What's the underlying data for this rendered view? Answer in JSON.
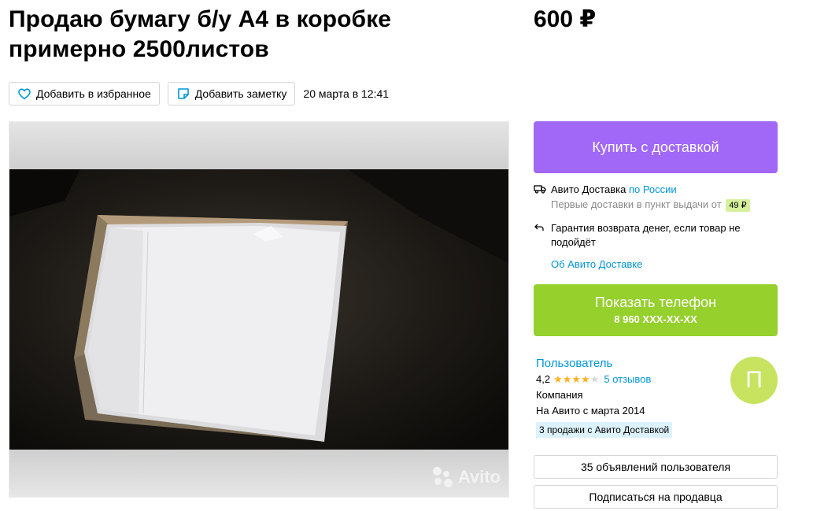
{
  "listing": {
    "title": "Продаю бумагу б/у А4 в коробке примерно 2500листов",
    "price": "600 ₽",
    "date": "20 марта в 12:41"
  },
  "actions": {
    "favorite_label": "Добавить в избранное",
    "note_label": "Добавить заметку"
  },
  "photo": {
    "watermark": "Avito"
  },
  "buy": {
    "label": "Купить с доставкой"
  },
  "delivery": {
    "service_label": "Авито Доставка",
    "region_link": "по России",
    "first_delivery_text": "Первые доставки в пункт выдачи от",
    "first_delivery_price": "49 ₽",
    "guarantee_text": "Гарантия возврата денег, если товар не подойдёт",
    "about_link": "Об Авито Доставке"
  },
  "phone": {
    "label": "Показать телефон",
    "number": "8 960 XXX-XX-XX"
  },
  "seller": {
    "name": "Пользователь",
    "rating": "4,2",
    "stars_filled": 4,
    "stars_total": 5,
    "reviews_link": "5 отзывов",
    "type": "Компания",
    "since": "На Авито с марта 2014",
    "sales_badge": "3 продажи с Авито Доставкой",
    "avatar_letter": "П",
    "avatar_color": "#c7e35f"
  },
  "buttons": {
    "listings": "35 объявлений пользователя",
    "subscribe": "Подписаться на продавца"
  },
  "colors": {
    "buy": "#a168f7",
    "phone": "#95d02c",
    "link": "#0096d9"
  }
}
